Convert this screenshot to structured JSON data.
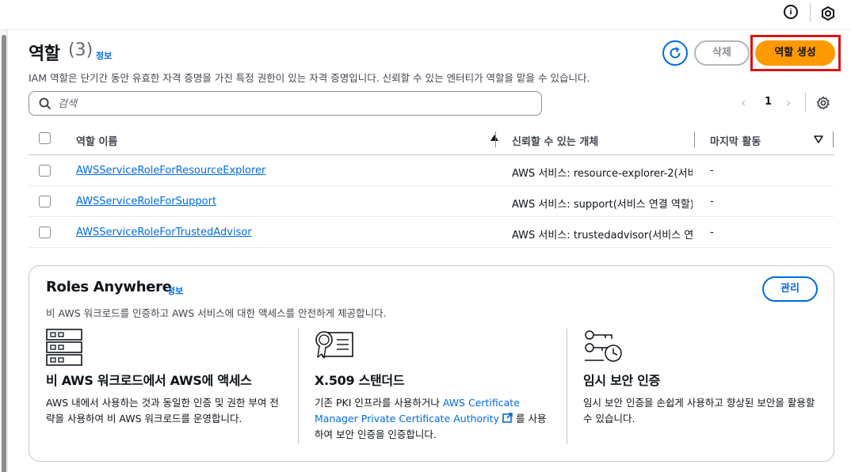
{
  "topbar": {
    "info_icon": "info-circle-icon",
    "hex_icon": "hexagon-settings-icon",
    "info_glyph": "i"
  },
  "header": {
    "title": "역할",
    "count": "(3)",
    "info": "정보",
    "description": "IAM 역할은 단기간 동안 유효한 자격 증명을 가진 특정 권한이 있는 자격 증명입니다. 신뢰할 수 있는 엔터티가 역할을 맡을 수 있습니다.",
    "delete_label": "삭제",
    "create_label": "역할 생성",
    "refresh_icon": "refresh-icon"
  },
  "search": {
    "placeholder": "검색",
    "value": ""
  },
  "pagination": {
    "prev": "‹",
    "page": "1",
    "next": "›"
  },
  "table": {
    "columns": [
      "역할 이름",
      "신뢰할 수 있는 개체",
      "마지막 활동"
    ],
    "rows": [
      {
        "name": "AWSServiceRoleForResourceExplorer",
        "trust_prefix": "AWS 서비스: resource-explorer-2",
        "trust_suffix": "(서비스 연결 역할)",
        "last": "-"
      },
      {
        "name": "AWSServiceRoleForSupport",
        "trust_prefix": "AWS 서비스: support",
        "trust_suffix": "(서비스 연결 역할)",
        "last": "-"
      },
      {
        "name": "AWSServiceRoleForTrustedAdvisor",
        "trust_prefix": "AWS 서비스: trustedadvisor",
        "trust_suffix": "(서비스 연결 역할)",
        "last": "-"
      }
    ]
  },
  "roles_anywhere": {
    "title": "Roles Anywhere",
    "info": "정보",
    "manage_label": "관리",
    "description": "비 AWS 워크로드를 인증하고 AWS 서비스에 대한 액세스를 안전하게 제공합니다.",
    "features": [
      {
        "heading": "비 AWS 워크로드에서 AWS에 액세스",
        "icon": "server-rack-icon",
        "body": "AWS 내에서 사용하는 것과 동일한 인증 및 권한 부여 전략을 사용하여 비 AWS 워크로드를 운영합니다."
      },
      {
        "heading": "X.509 스탠더드",
        "icon": "certificate-icon",
        "body_prefix": "기존 PKI 인프라를 사용하거나 ",
        "link": "AWS Certificate Manager Private Certificate Authority",
        "body_suffix": " 를 사용하여 보안 인증을 인증합니다."
      },
      {
        "heading": "임시 보안 인증",
        "icon": "keys-clock-icon",
        "body": "임시 보안 인증을 손쉽게 사용하고 향상된 보안을 활용할 수 있습니다."
      }
    ]
  },
  "colors": {
    "accent": "#006ce0",
    "primary": "#ff9900",
    "highlight": "#d91515"
  }
}
